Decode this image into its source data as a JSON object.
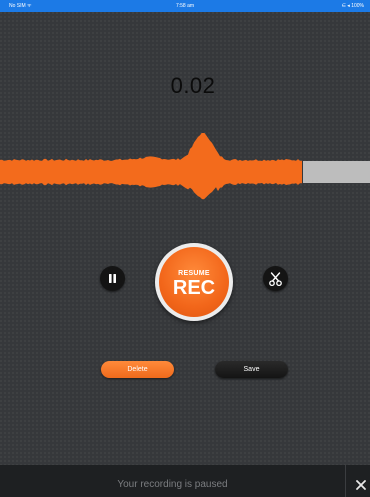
{
  "status_bar": {
    "carrier": "No SIM ᯤ",
    "time": "7:58 am",
    "right": "∈ ◂ 100%"
  },
  "recorder": {
    "timer": "0.02",
    "recorded_fraction": 0.82,
    "resume_label": "RESUME",
    "rec_label": "REC",
    "icons": {
      "pause": "pause-icon",
      "scissors": "scissors-icon",
      "close": "close-icon"
    }
  },
  "actions": {
    "delete_label": "Delete",
    "save_label": "Save"
  },
  "footer": {
    "message": "Your recording is paused"
  },
  "colors": {
    "accent": "#f36b1c",
    "status_bar": "#1c7ae6",
    "background": "#36383b",
    "unrecorded_wave": "#bdbdbd"
  }
}
